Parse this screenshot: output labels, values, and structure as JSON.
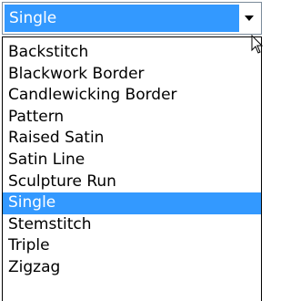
{
  "dropdown": {
    "selected_value": "Single",
    "options": [
      "Backstitch",
      "Blackwork Border",
      "Candlewicking Border",
      "Pattern",
      "Raised Satin",
      "Satin Line",
      "Sculpture Run",
      "Single",
      "Stemstitch",
      "Triple",
      "Zigzag"
    ],
    "highlighted_index": 7,
    "arrow_icon": "chevron-down-icon",
    "cursor_icon": "mouse-pointer-icon"
  },
  "colors": {
    "highlight": "#3399ff",
    "highlight_text": "#ffffff",
    "border": "#7a8a99"
  }
}
